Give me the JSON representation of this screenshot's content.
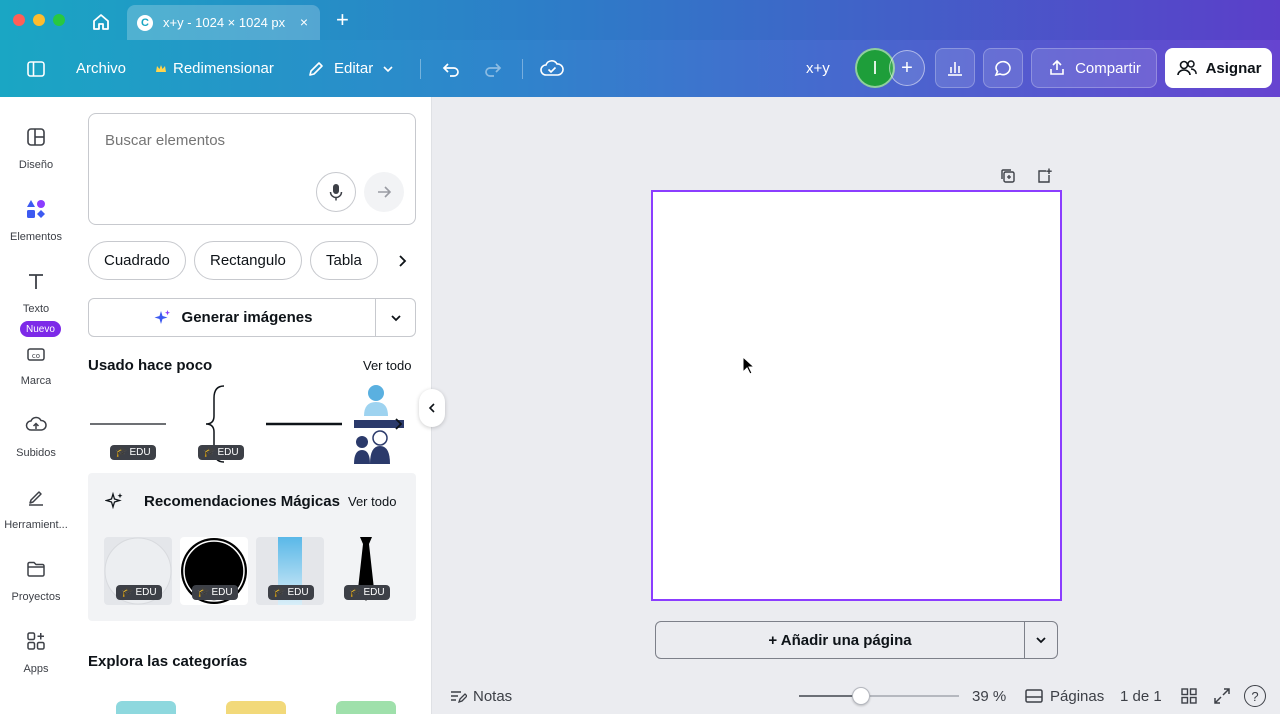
{
  "browser": {
    "tab_title": "x+y - 1024 × 1024 px",
    "tab_logo": "C",
    "tab_close": "×",
    "new_tab": "+"
  },
  "toolbar": {
    "archivo": "Archivo",
    "redimensionar": "Redimensionar",
    "editar": "Editar",
    "doc_title": "x+y",
    "avatar_initial": "I",
    "compartir": "Compartir",
    "asignar": "Asignar"
  },
  "rail": {
    "items": [
      {
        "label": "Diseño",
        "icon": "layout-icon"
      },
      {
        "label": "Elementos",
        "icon": "shapes-icon"
      },
      {
        "label": "Texto",
        "icon": "text-icon"
      },
      {
        "label": "Marca",
        "icon": "brand-icon"
      },
      {
        "label": "Subidos",
        "icon": "cloud-upload-icon"
      },
      {
        "label": "Herramient...",
        "icon": "pen-icon"
      },
      {
        "label": "Proyectos",
        "icon": "folder-icon"
      },
      {
        "label": "Apps",
        "icon": "apps-icon"
      }
    ],
    "badge": "Nuevo"
  },
  "panel": {
    "search_placeholder": "Buscar elementos",
    "chips": [
      "Cuadrado",
      "Rectangulo",
      "Tabla"
    ],
    "generate": "Generar imágenes",
    "recent_title": "Usado hace poco",
    "see_all": "Ver todo",
    "magic_title": "Recomendaciones Mágicas",
    "magic_see_all": "Ver todo",
    "edu": "EDU",
    "categories_title": "Explora las categorías"
  },
  "canvas": {
    "add_page": "+ Añadir una página"
  },
  "bottombar": {
    "notes": "Notas",
    "zoom": "39 %",
    "zoom_fraction": 0.39,
    "pages": "Páginas",
    "page_count": "1 de 1",
    "help": "?"
  },
  "colors": {
    "accent": "#8b3dff",
    "avatar": "#1e9e3a",
    "badge": "#7d2ae8"
  }
}
